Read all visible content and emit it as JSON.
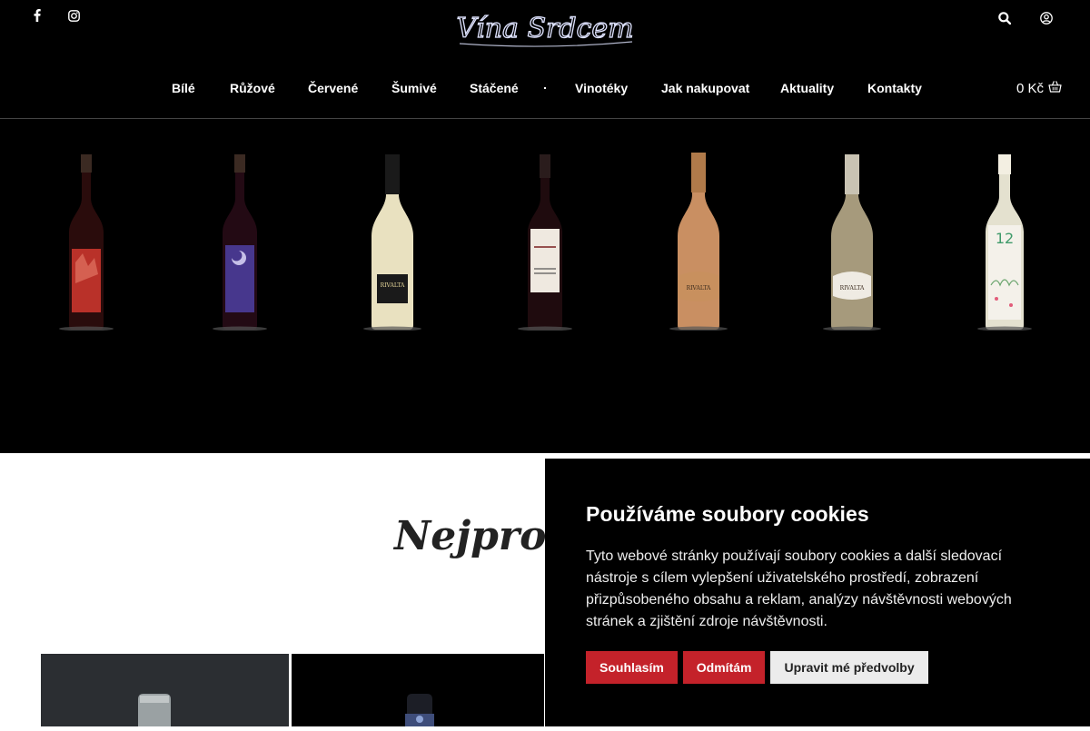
{
  "brand": {
    "logo_text": "Vína Srdcem"
  },
  "social": [
    {
      "name": "facebook-icon"
    },
    {
      "name": "instagram-icon"
    }
  ],
  "top_right": [
    {
      "name": "search-icon"
    },
    {
      "name": "account-icon"
    }
  ],
  "nav": {
    "items": [
      "Bílé",
      "Růžové",
      "Červené",
      "Šumivé",
      "Stáčené",
      "Vinotéky",
      "Jak nakupovat",
      "Aktuality",
      "Kontakty"
    ]
  },
  "cart": {
    "total": "0 Kč",
    "icon": "basket-icon"
  },
  "hero": {
    "bottles": [
      {
        "name": "red-label-red-wine",
        "glass": "#2a0c0c",
        "label": "#c9352c"
      },
      {
        "name": "blue-label-red-wine",
        "glass": "#230a14",
        "label": "#4b3c9a"
      },
      {
        "name": "rivalta-white-sparkling",
        "glass": "#e9e1c0",
        "label": "#1a1a1a"
      },
      {
        "name": "primitivo-red-wine",
        "glass": "#1f0b0e",
        "label": "#efe9e0"
      },
      {
        "name": "rivalta-rose-sparkling",
        "glass": "#c98f62",
        "label": "#c8905e"
      },
      {
        "name": "rivalta-brut-sparkling",
        "glass": "#a69a7c",
        "label": "#efebe3"
      },
      {
        "name": "floral-white-wine",
        "glass": "#e4e1cf",
        "label": "#f4f1ea"
      }
    ]
  },
  "section": {
    "title": "Nejprodáv"
  },
  "cookie": {
    "title": "Používáme soubory cookies",
    "text": "Tyto webové stránky používají soubory cookies a další sledovací nástroje s cílem vylepšení uživatelského prostředí, zobrazení přizpůsobeného obsahu a reklam, analýzy návštěvnosti webových stránek a zjištění zdroje návštěvnosti.",
    "accept": "Souhlasím",
    "reject": "Odmítám",
    "preferences": "Upravit mé předvolby"
  }
}
